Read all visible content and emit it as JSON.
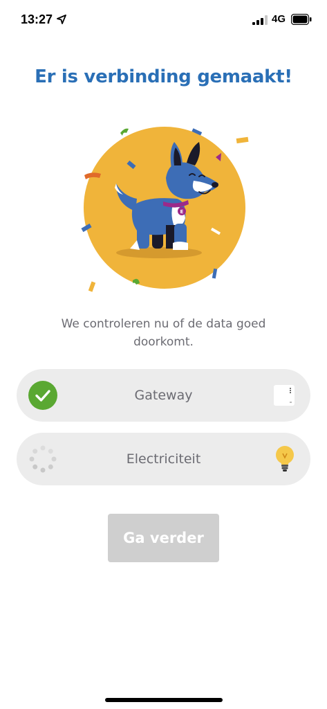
{
  "status_bar": {
    "time": "13:27",
    "network": "4G",
    "icons": [
      "location-arrow-icon",
      "cellular-signal-icon",
      "battery-icon"
    ]
  },
  "title": "Er is verbinding gemaakt!",
  "description": "We controleren nu of de data goed doorkomt.",
  "checks": [
    {
      "label": "Gateway",
      "status": "done",
      "status_icon": "checkmark-icon",
      "device_icon": "gateway-device-icon"
    },
    {
      "label": "Electriciteit",
      "status": "loading",
      "status_icon": "spinner-icon",
      "device_icon": "lightbulb-icon"
    }
  ],
  "continue_button": {
    "label": "Ga verder",
    "enabled": false
  },
  "colors": {
    "title": "#2a6fb6",
    "check_green": "#5aa832",
    "row_background": "#ececec",
    "button_disabled": "#cfcfcf",
    "illustration_circle": "#f0b43a",
    "dog_blue": "#3d6db6"
  }
}
